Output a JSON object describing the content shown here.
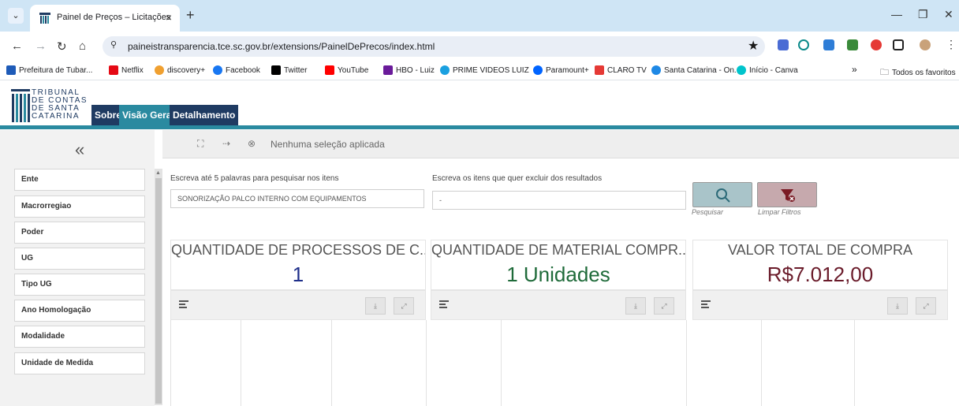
{
  "browser": {
    "tab_title": "Painel de Preços – Licitações",
    "tab_close": "×",
    "new_tab": "+",
    "url": "paineistransparencia.tce.sc.gov.br/extensions/PainelDePrecos/index.html",
    "bookmarks": [
      {
        "label": "Prefeitura de Tubar...",
        "color": "#1e5bb8"
      },
      {
        "label": "Netflix",
        "color": "#e50914"
      },
      {
        "label": "discovery+",
        "color": "#f0a030"
      },
      {
        "label": "Facebook",
        "color": "#1877f2"
      },
      {
        "label": "Twitter",
        "color": "#000000"
      },
      {
        "label": "YouTube",
        "color": "#ff0000"
      },
      {
        "label": "HBO - Luiz",
        "color": "#6a1b9a"
      },
      {
        "label": "PRIME VIDEOS LUIZ",
        "color": "#1aa0e0"
      },
      {
        "label": "Paramount+",
        "color": "#0064ff"
      },
      {
        "label": "CLARO TV",
        "color": "#e53935"
      },
      {
        "label": "Santa Catarina - On...",
        "color": "#1e88e5"
      },
      {
        "label": "Início - Canva",
        "color": "#00c4cc"
      }
    ],
    "bookmarks_more": "»",
    "all_favorites": "Todos os favoritos"
  },
  "app": {
    "logo_lines": [
      "TRIBUNAL",
      "DE CONTAS",
      "DE SANTA",
      "CATARINA"
    ],
    "tabs": [
      {
        "label": "Sobre",
        "color": "#1f3b62"
      },
      {
        "label": "Visão Geral",
        "color": "#2a8aa0"
      },
      {
        "label": "Detalhamento",
        "color": "#1f3b62"
      }
    ],
    "collapse": "«",
    "filters": [
      "Ente",
      "Macrorregiao",
      "Poder",
      "UG",
      "Tipo UG",
      "Ano Homologação",
      "Modalidade",
      "Unidade de Medida"
    ],
    "selection_text": "Nenhuma seleção aplicada",
    "search": {
      "label": "Escreva até 5 palavras para pesquisar nos itens",
      "value": "SONORIZAÇÃO PALCO INTERNO COM EQUIPAMENTOS",
      "exclude_label": "Escreva os itens que quer excluir dos resultados",
      "exclude_value": "-",
      "search_caption": "Pesquisar",
      "clear_caption": "Limpar Filtros"
    },
    "kpis": [
      {
        "title": "QUANTIDADE DE PROCESSOS DE C...",
        "value": "1",
        "color": "#1f2f8a"
      },
      {
        "title": "QUANTIDADE DE MATERIAL COMPR...",
        "value": "1 Unidades",
        "color": "#1f6b3a"
      },
      {
        "title": "VALOR TOTAL DE COMPRA",
        "value": "R$7.012,00",
        "color": "#6a1b2a"
      }
    ]
  }
}
